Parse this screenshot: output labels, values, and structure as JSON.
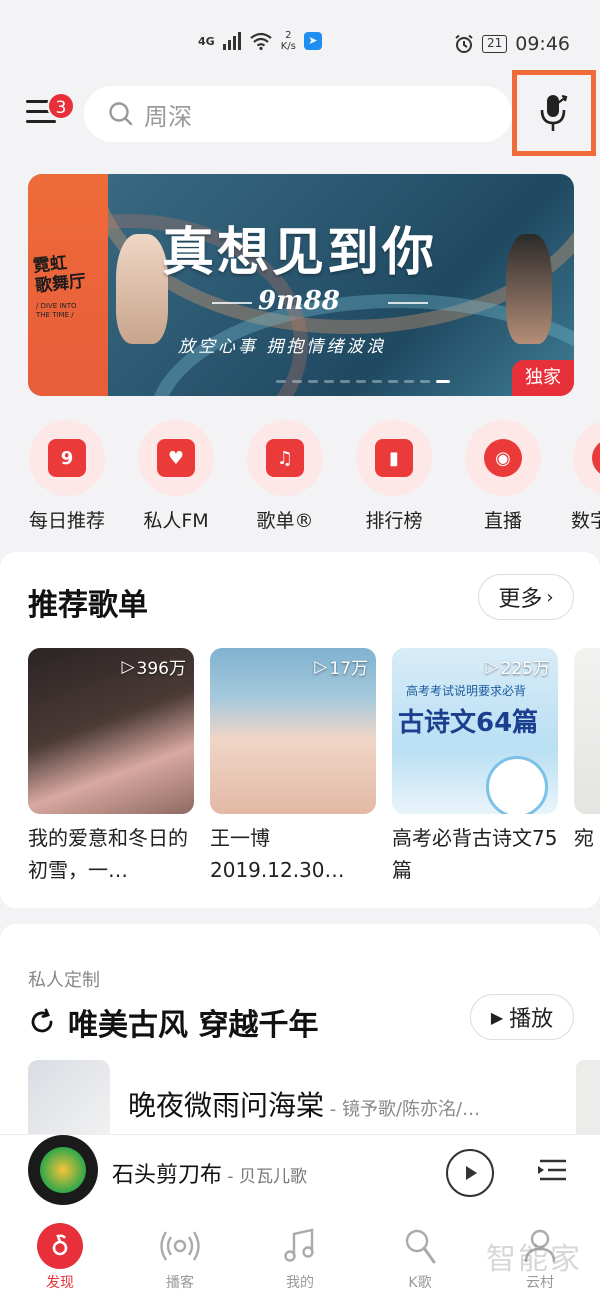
{
  "status_bar": {
    "network": "4G",
    "net_speed_value": "2",
    "net_speed_unit": "K/s",
    "battery": "21",
    "time": "09:46"
  },
  "header": {
    "menu_badge": "3",
    "search_placeholder": "周深"
  },
  "banner": {
    "title": "真想见到你",
    "code": "9m88",
    "subtitle": "放空心事  拥抱情绪波浪",
    "side_title": "霓虹\n歌舞厅",
    "side_sub": "/ DIVE INTO\nTHE TIME /",
    "tag": "独家"
  },
  "quick_entries": [
    {
      "label": "每日推荐",
      "icon": "calendar-icon",
      "glyph": "9"
    },
    {
      "label": "私人FM",
      "icon": "radio-icon",
      "glyph": "♥"
    },
    {
      "label": "歌单®",
      "icon": "playlist-icon",
      "glyph": "♫"
    },
    {
      "label": "排行榜",
      "icon": "chart-icon",
      "glyph": "▮"
    },
    {
      "label": "直播",
      "icon": "live-icon",
      "glyph": "◉"
    },
    {
      "label": "数字",
      "icon": "digital-icon",
      "glyph": "◎"
    }
  ],
  "recommend": {
    "title": "推荐歌单",
    "more_label": "更多",
    "playlists": [
      {
        "count": "396万",
        "title": "我的爱意和冬日的初雪，一…"
      },
      {
        "count": "17万",
        "title": "王一博2019.12.30…"
      },
      {
        "count": "225万",
        "title": "高考必背古诗文75篇"
      },
      {
        "count": "",
        "title": "宛"
      }
    ],
    "cover3_text_top": "高考考试说明要求必背",
    "cover3_text_main": "古诗文64篇"
  },
  "personal": {
    "subtitle": "私人定制",
    "title": "唯美古风 穿越千年",
    "play_label": "播放",
    "song_title": "晚夜微雨问海棠",
    "song_artist": " - 镜予歌/陈亦洺/…"
  },
  "player": {
    "title": "石头剪刀布",
    "artist": " - 贝瓦儿歌"
  },
  "tabs": [
    {
      "label": "发现",
      "icon": "discover-icon",
      "active": true
    },
    {
      "label": "播客",
      "icon": "podcast-icon",
      "active": false
    },
    {
      "label": "我的",
      "icon": "music-note-icon",
      "active": false
    },
    {
      "label": "K歌",
      "icon": "karaoke-mic-icon",
      "active": false
    },
    {
      "label": "云村",
      "icon": "community-icon",
      "active": false
    }
  ],
  "watermark": "智能家",
  "colors": {
    "brand_red": "#e8303a",
    "highlight_orange": "#f06a3a"
  }
}
